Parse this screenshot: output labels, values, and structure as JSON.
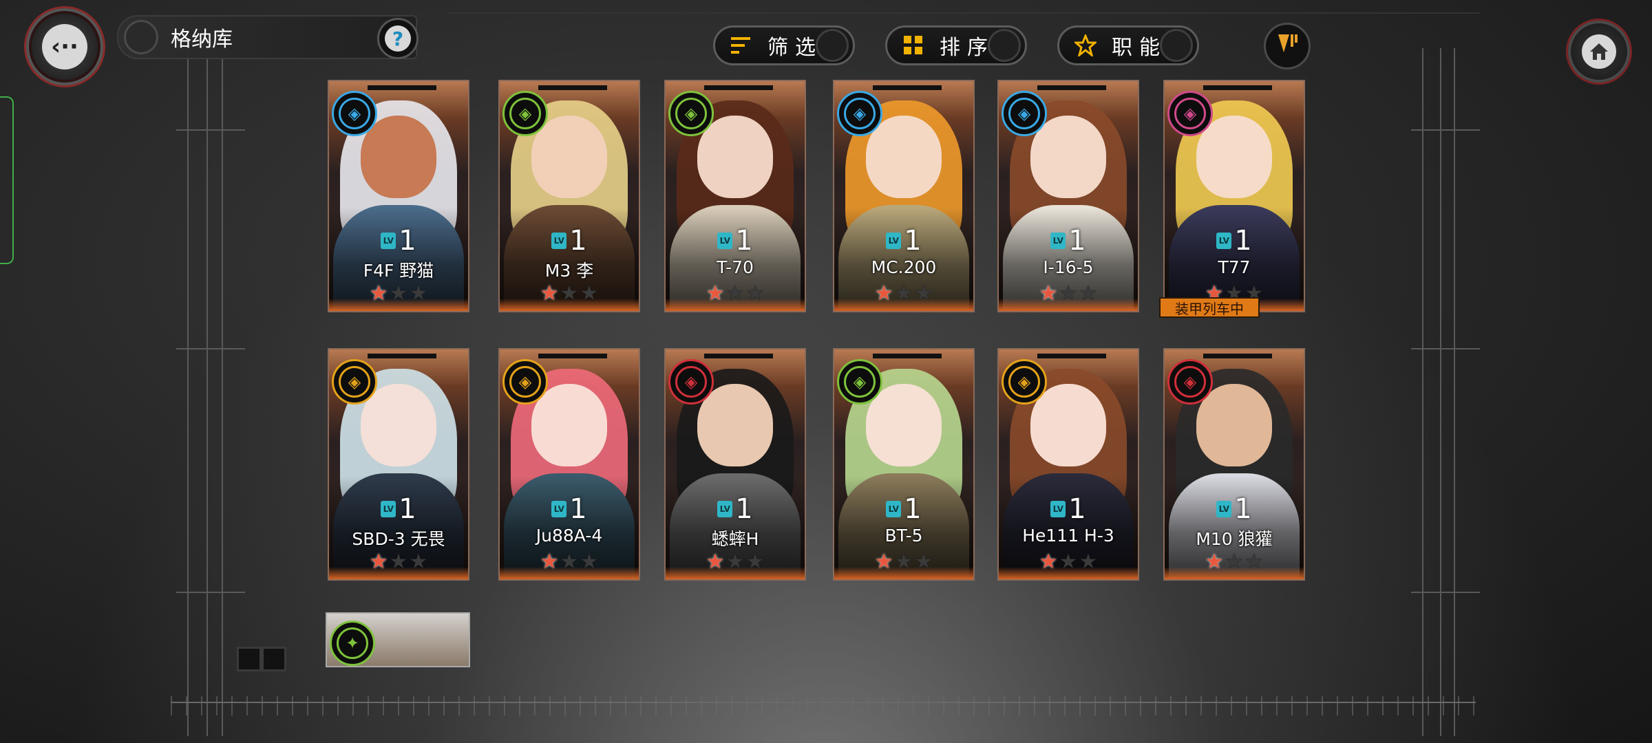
{
  "header": {
    "title": "格纳库",
    "help_label": "?"
  },
  "toolbar": {
    "filter_label": "筛选",
    "sort_label": "排序",
    "role_label": "职能"
  },
  "icons": {
    "back": "back-arrow-icon",
    "help": "help-icon",
    "filter": "filter-lines-icon",
    "sort": "grid-squares-icon",
    "role": "star-icon",
    "rank": "rank-chevron-icon",
    "home": "home-icon"
  },
  "colors": {
    "accent": "#f2b300",
    "star_on": "#e8583e",
    "level_tag": "#2fb7c7",
    "status_tag": "#e07a16",
    "home_ring": "#7a2323"
  },
  "level_prefix": "LV",
  "cards": [
    {
      "name": "F4F 野猫",
      "level": "1",
      "stars": 1,
      "class_icon": "fighter-icon",
      "class_color": "#3aa9e6"
    },
    {
      "name": "M3 李",
      "level": "1",
      "stars": 1,
      "class_icon": "tank-destroyer-icon",
      "class_color": "#7ec23b"
    },
    {
      "name": "T-70",
      "level": "1",
      "stars": 1,
      "class_icon": "light-tank-icon",
      "class_color": "#7ec23b"
    },
    {
      "name": "MC.200",
      "level": "1",
      "stars": 1,
      "class_icon": "fighter-icon",
      "class_color": "#3aa9e6"
    },
    {
      "name": "I-16-5",
      "level": "1",
      "stars": 1,
      "class_icon": "interceptor-icon",
      "class_color": "#3aa9e6"
    },
    {
      "name": "T77",
      "level": "1",
      "stars": 1,
      "class_icon": "anti-air-icon",
      "class_color": "#d04a8a",
      "status": "装甲列车中"
    },
    {
      "name": "SBD-3 无畏",
      "level": "1",
      "stars": 1,
      "class_icon": "dive-bomber-icon",
      "class_color": "#e4a21a"
    },
    {
      "name": "Ju88A-4",
      "level": "1",
      "stars": 1,
      "class_icon": "bomber-icon",
      "class_color": "#e4a21a"
    },
    {
      "name": "蟋蟀H",
      "level": "1",
      "stars": 1,
      "class_icon": "self-propelled-gun-icon",
      "class_color": "#d0303a"
    },
    {
      "name": "BT-5",
      "level": "1",
      "stars": 1,
      "class_icon": "light-tank-icon",
      "class_color": "#7ec23b"
    },
    {
      "name": "He111 H-3",
      "level": "1",
      "stars": 1,
      "class_icon": "bomber-icon",
      "class_color": "#e4a21a"
    },
    {
      "name": "M10 狼獾",
      "level": "1",
      "stars": 1,
      "class_icon": "self-propelled-gun-icon",
      "class_color": "#d0303a"
    }
  ],
  "partial_card": {
    "class_icon": "light-tank-icon",
    "class_color": "#7ec23b"
  }
}
